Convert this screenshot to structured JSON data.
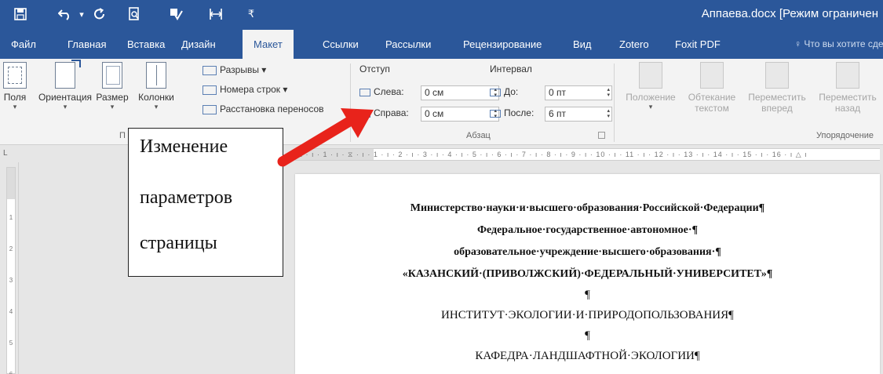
{
  "titlebar": {
    "doc_title": "Аппаева.docx [Режим ограничен",
    "qat": [
      {
        "icon": "save-icon",
        "glyph": "💾"
      },
      {
        "icon": "undo-icon",
        "glyph": "↶"
      },
      {
        "icon": "redo-icon",
        "glyph": "↻"
      },
      {
        "icon": "print-preview-icon",
        "glyph": "🗎"
      },
      {
        "icon": "spelling-icon",
        "glyph": "✎"
      },
      {
        "icon": "layout-icon",
        "glyph": "⊟"
      },
      {
        "icon": "customize-qat-icon",
        "glyph": "⇣"
      }
    ]
  },
  "tabs": [
    "Файл",
    "Главная",
    "Вставка",
    "Дизайн",
    "Макет",
    "Ссылки",
    "Рассылки",
    "Рецензирование",
    "Вид",
    "Zotero",
    "Foxit PDF"
  ],
  "active_tab": "Макет",
  "tell_me": "Что вы хотите сделать?",
  "page_setup": {
    "fields": "Поля",
    "orientation": "Ориентация",
    "size": "Размер",
    "columns": "Колонки",
    "breaks": "Разрывы",
    "line_numbers": "Номера строк",
    "hyphenation": "Расстановка переносов",
    "group_label": "П"
  },
  "paragraph": {
    "indent_label": "Отступ",
    "spacing_label": "Интервал",
    "left_label": "Слева:",
    "left_value": "0 см",
    "right_label": "Справа:",
    "right_value": "0 см",
    "before_label": "До:",
    "before_value": "0 пт",
    "after_label": "После:",
    "after_value": "6 пт",
    "group_label": "Абзац"
  },
  "arrange": {
    "position": "Положение",
    "wrap_line1": "Обтекание",
    "wrap_line2": "текстом",
    "forward_line1": "Переместить",
    "forward_line2": "вперед",
    "backward_line1": "Переместить",
    "backward_line2": "назад",
    "group_label": "Упорядочение"
  },
  "ruler": {
    "ticks": "2 · ı · 1 · ı · ⧖ · ı · 1 · ı · 2 · ı · 3 · ı · 4 · ı · 5 · ı · 6 · ı · 7 · ı · 8 · ı · 9 · ı · 10 · ı · 11 · ı · 12 · ı · 13 · ı · 14 · ı · 15 · ı · 16 · ı △ ı",
    "vticks": [
      "1",
      "2",
      "3",
      "4",
      "5",
      "6"
    ]
  },
  "callout": {
    "lines": [
      "Изменение",
      "параметров",
      "страницы"
    ]
  },
  "document": {
    "lines": [
      {
        "text": "Министерство·науки·и·высшего·образования·Российской·Федерации¶",
        "bold": true
      },
      {
        "text": "Федеральное·государственное·автономное·¶",
        "bold": true
      },
      {
        "text": "образовательное·учреждение·высшего·образования·¶",
        "bold": true
      },
      {
        "text": "«КАЗАНСКИЙ·(ПРИВОЛЖСКИЙ)·ФЕДЕРАЛЬНЫЙ·УНИВЕРСИТЕТ»¶",
        "bold": true
      },
      {
        "text": "¶",
        "bold": false
      },
      {
        "text": "ИНСТИТУТ·ЭКОЛОГИИ·И·ПРИРОДОПОЛЬЗОВАНИЯ¶",
        "bold": false
      },
      {
        "text": "¶",
        "bold": false
      },
      {
        "text": "КАФЕДРА·ЛАНДШАФТНОЙ·ЭКОЛОГИИ¶",
        "bold": false
      }
    ]
  },
  "colors": {
    "ribbon_blue": "#2b579a",
    "arrow_red": "#e8231b"
  }
}
